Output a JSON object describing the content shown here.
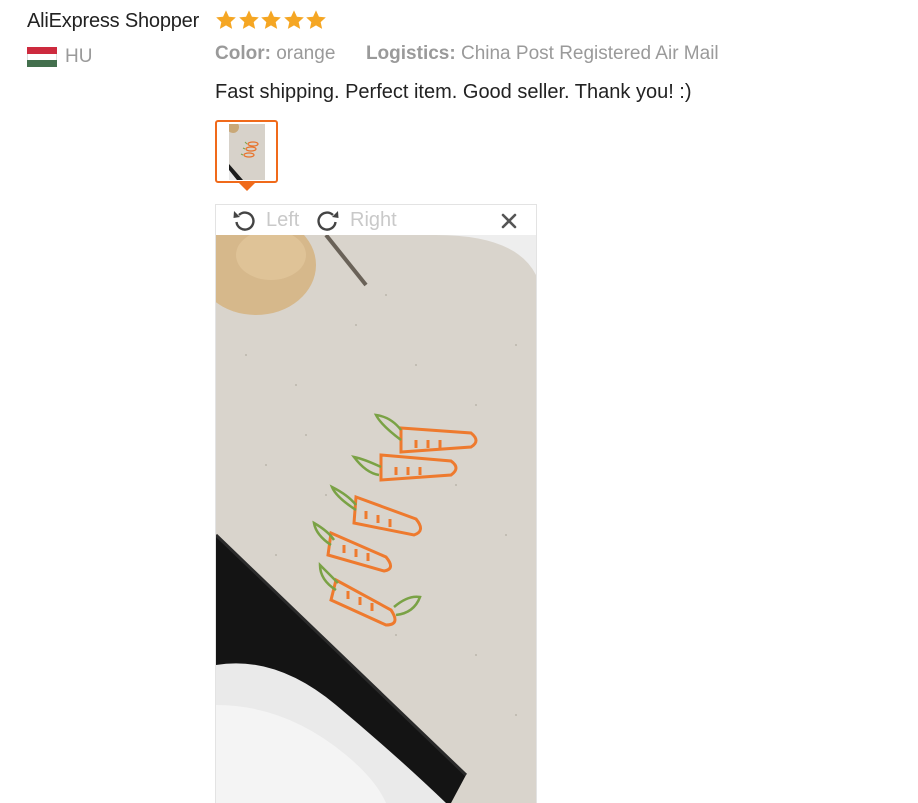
{
  "review": {
    "user_name": "AliExpress Shopper",
    "country_code": "HU",
    "flag_colors": [
      "#cd2a3e",
      "#ffffff",
      "#436f4d"
    ],
    "rating": 5,
    "star_color": "#f5a623",
    "meta": {
      "color_label": "Color:",
      "color_value": "orange",
      "logistics_label": "Logistics:",
      "logistics_value": "China Post Registered Air Mail"
    },
    "text": "Fast shipping. Perfect item. Good seller. Thank you! :)"
  },
  "viewer": {
    "rotate_left_label": "Left",
    "rotate_right_label": "Right",
    "accent_color": "#f06a1a"
  }
}
